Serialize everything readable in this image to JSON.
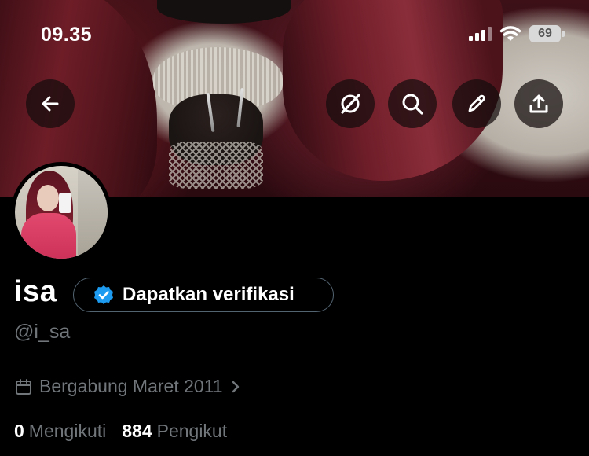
{
  "status_bar": {
    "time": "09.35",
    "battery": "69",
    "icons": [
      "cellular-signal-icon",
      "wifi-icon",
      "battery-icon"
    ]
  },
  "top_actions": {
    "back": "back-arrow-icon",
    "grok": "grok-icon",
    "search": "search-icon",
    "edit": "pencil-icon",
    "share": "share-icon"
  },
  "profile": {
    "display_name": "isa",
    "handle": "@i_sa",
    "verify_button_label": "Dapatkan verifikasi",
    "joined_text": "Bergabung Maret 2011",
    "following_count": "0",
    "following_label": "Mengikuti",
    "followers_count": "884",
    "followers_label": "Pengikut"
  },
  "colors": {
    "background": "#000000",
    "primary_text": "#ffffff",
    "secondary_text": "#71767b",
    "verified_badge": "#1d9bf0",
    "pill_border": "#536471"
  }
}
